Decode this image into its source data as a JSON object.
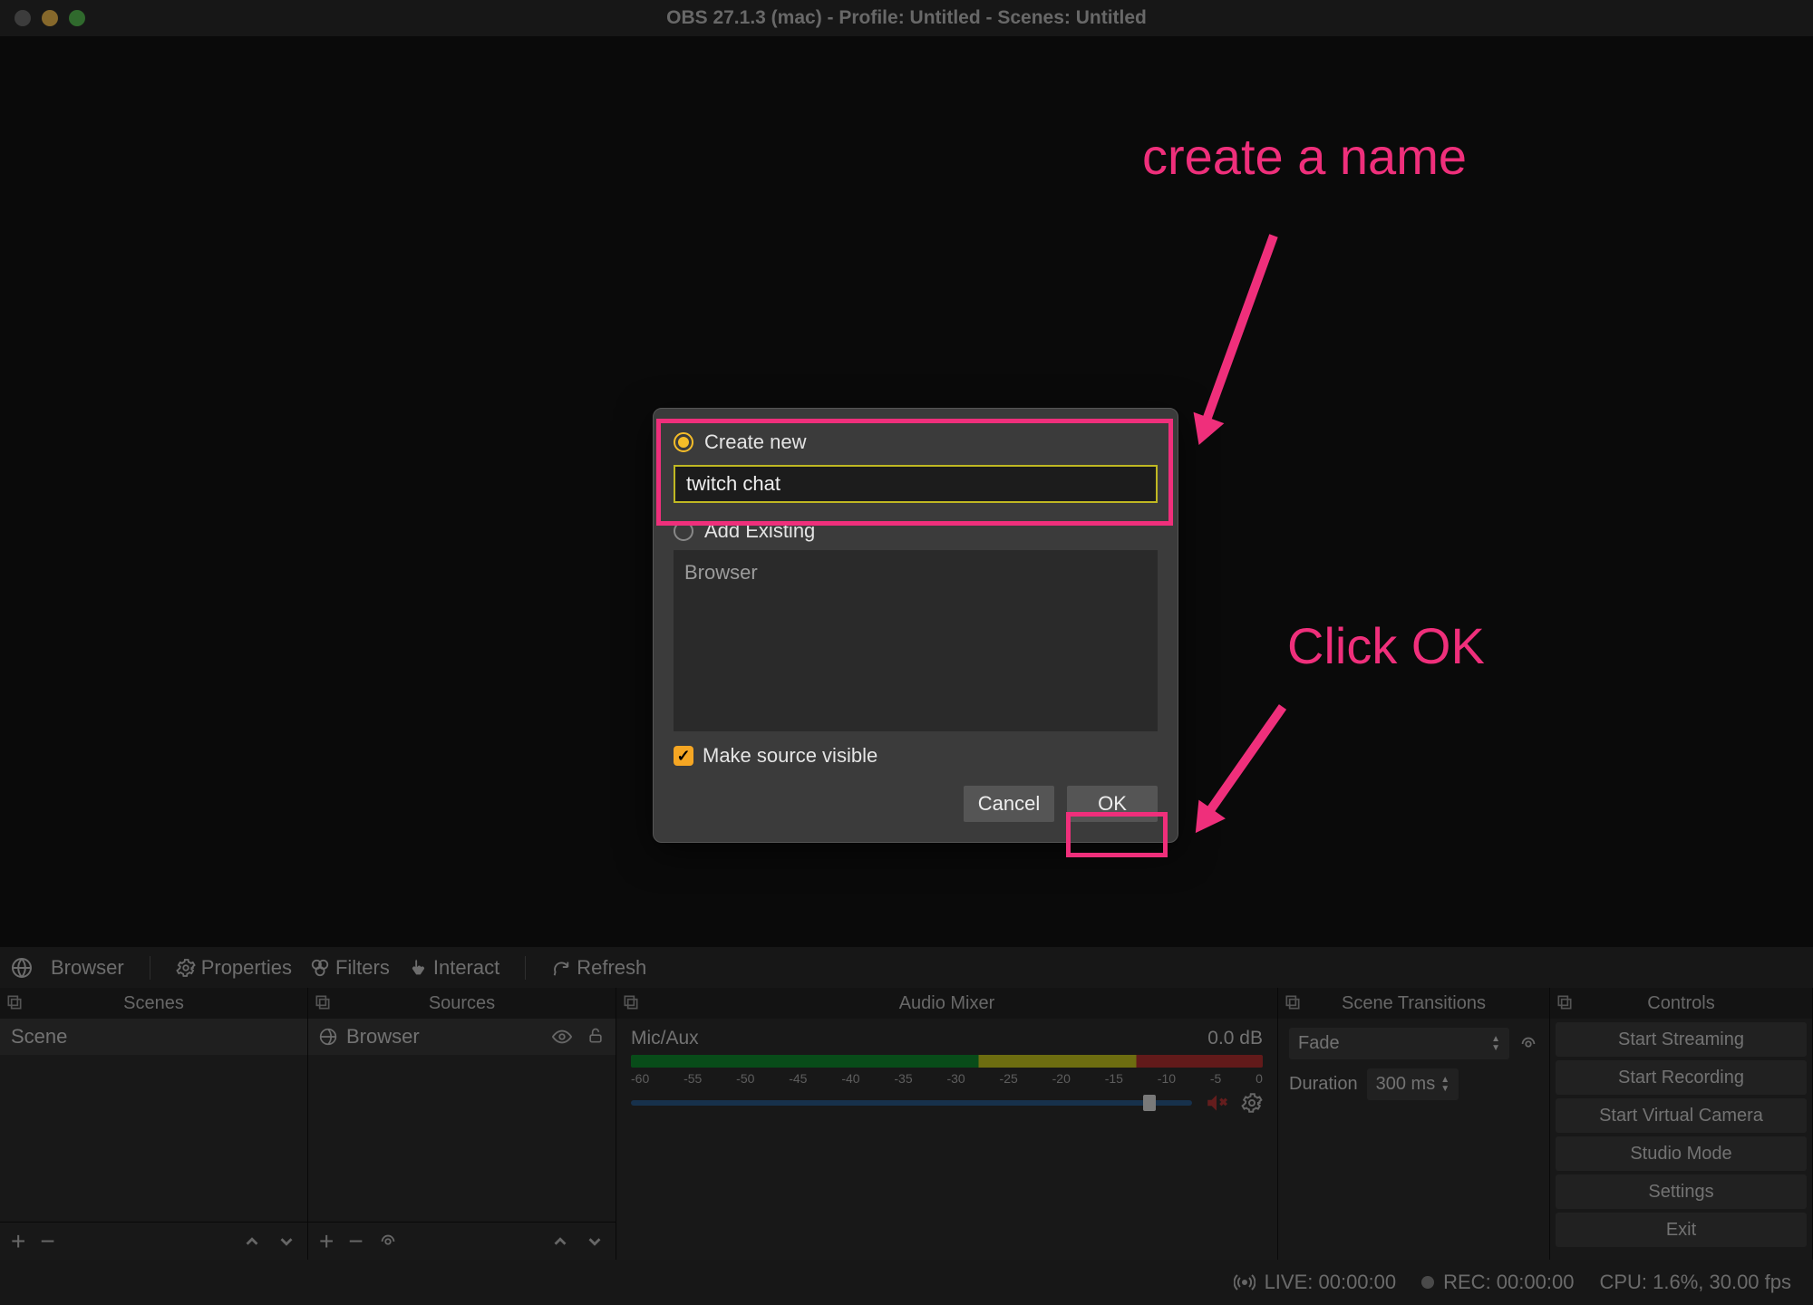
{
  "window": {
    "title": "OBS 27.1.3 (mac) - Profile: Untitled - Scenes: Untitled"
  },
  "source_toolbar": {
    "selected_label": "Browser",
    "properties": "Properties",
    "filters": "Filters",
    "interact": "Interact",
    "refresh": "Refresh"
  },
  "panels": {
    "scenes": {
      "title": "Scenes",
      "items": [
        "Scene"
      ]
    },
    "sources": {
      "title": "Sources",
      "items": [
        "Browser"
      ]
    },
    "audio": {
      "title": "Audio Mixer",
      "tracks": [
        {
          "name": "Mic/Aux",
          "level": "0.0 dB",
          "ticks": [
            "-60",
            "-55",
            "-50",
            "-45",
            "-40",
            "-35",
            "-30",
            "-25",
            "-20",
            "-15",
            "-10",
            "-5",
            "0"
          ]
        }
      ]
    },
    "transitions": {
      "title": "Scene Transitions",
      "selected": "Fade",
      "duration_label": "Duration",
      "duration_value": "300 ms"
    },
    "controls": {
      "title": "Controls",
      "buttons": [
        "Start Streaming",
        "Start Recording",
        "Start Virtual Camera",
        "Studio Mode",
        "Settings",
        "Exit"
      ]
    }
  },
  "dialog": {
    "create_new": "Create new",
    "name_value": "twitch chat",
    "add_existing": "Add Existing",
    "existing_items": [
      "Browser"
    ],
    "make_visible": "Make source visible",
    "cancel": "Cancel",
    "ok": "OK"
  },
  "statusbar": {
    "live": "LIVE: 00:00:00",
    "rec": "REC: 00:00:00",
    "cpu": "CPU: 1.6%, 30.00 fps"
  },
  "annotations": {
    "create_name": "create a name",
    "click_ok": "Click OK"
  }
}
